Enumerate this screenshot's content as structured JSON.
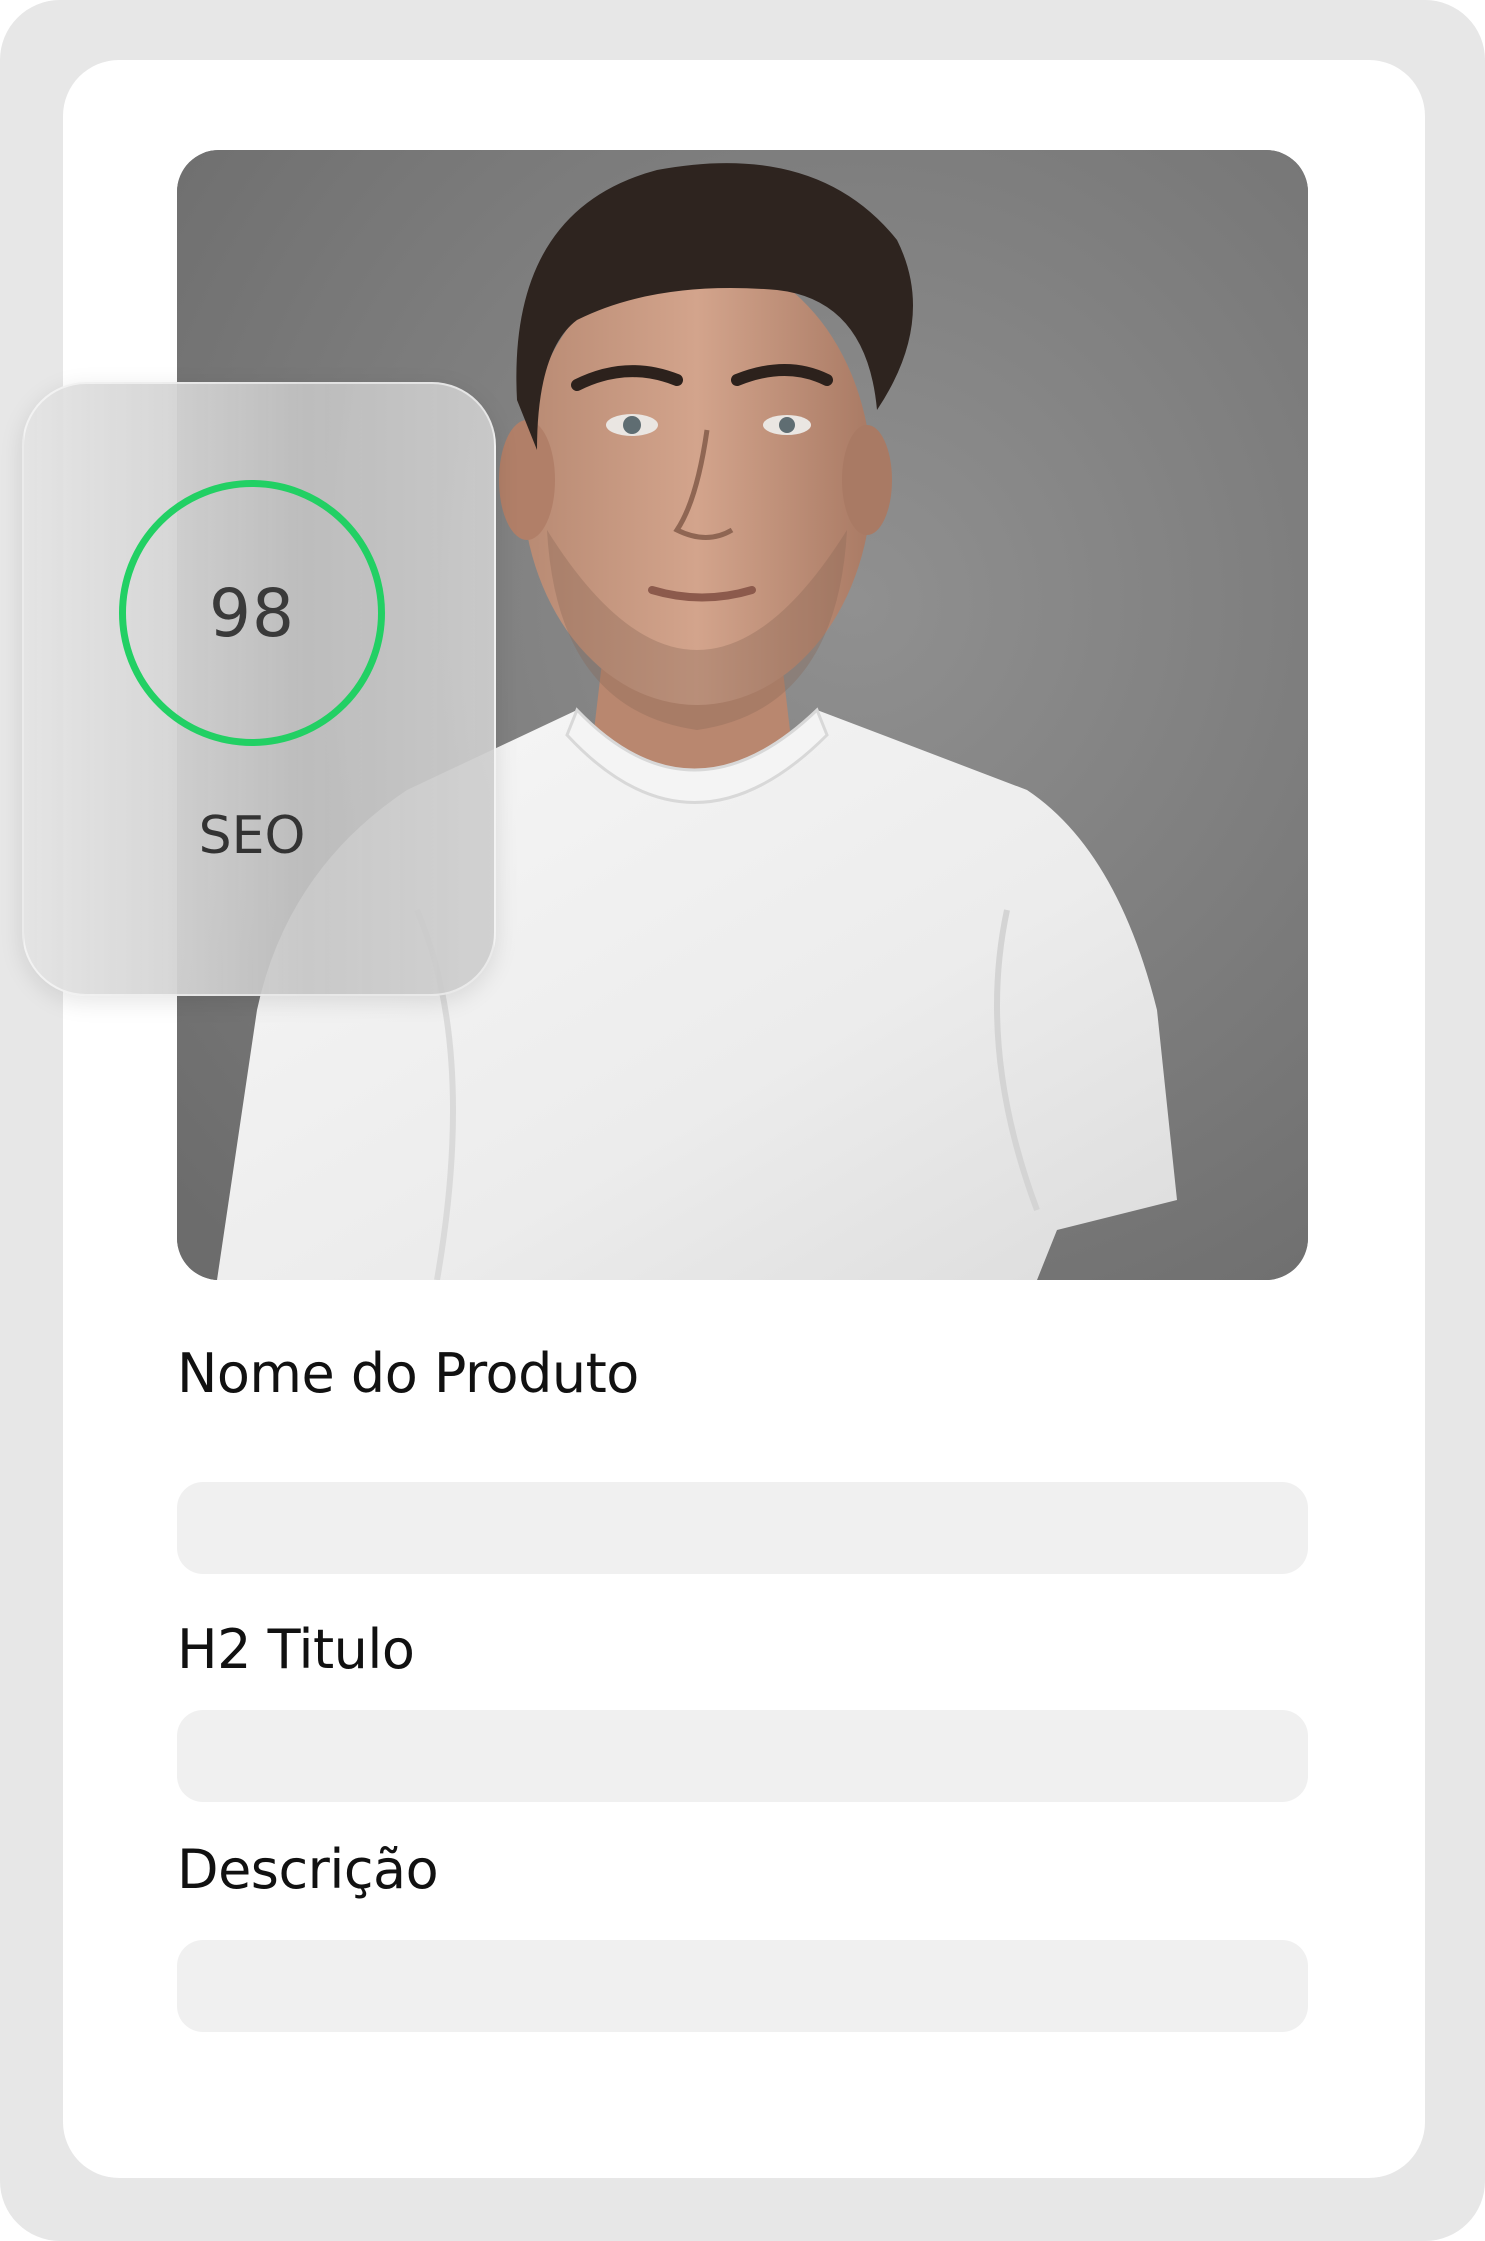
{
  "seo": {
    "score": "98",
    "label": "SEO",
    "ring_color": "#22d064"
  },
  "product_image": {
    "description_icon": "product-photo-man-white-tshirt"
  },
  "form": {
    "fields": [
      {
        "label": "Nome do Produto",
        "value": ""
      },
      {
        "label": "H2 Titulo",
        "value": ""
      },
      {
        "label": "Descrição",
        "value": ""
      }
    ]
  }
}
